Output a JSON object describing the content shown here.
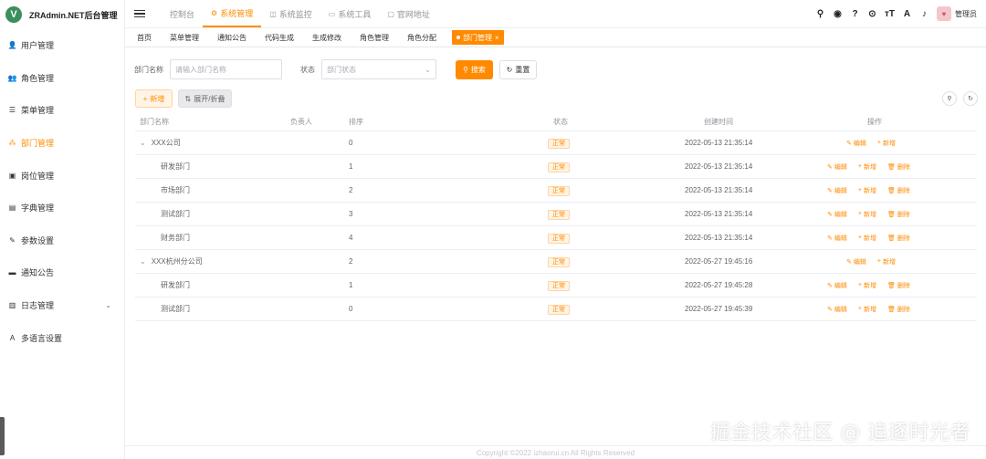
{
  "app": {
    "logo_letter": "V",
    "title": "ZRAdmin.NET后台管理"
  },
  "sidebar": {
    "items": [
      {
        "label": "用户管理",
        "icon": "user-icon",
        "glyph": "👤",
        "active": false
      },
      {
        "label": "角色管理",
        "icon": "role-icon",
        "glyph": "👥",
        "active": false
      },
      {
        "label": "菜单管理",
        "icon": "menu-list-icon",
        "glyph": "☰",
        "active": false
      },
      {
        "label": "部门管理",
        "icon": "tree-icon",
        "glyph": "⁂",
        "active": true
      },
      {
        "label": "岗位管理",
        "icon": "post-icon",
        "glyph": "▣",
        "active": false
      },
      {
        "label": "字典管理",
        "icon": "dict-icon",
        "glyph": "▤",
        "active": false
      },
      {
        "label": "参数设置",
        "icon": "edit-icon",
        "glyph": "✎",
        "active": false
      },
      {
        "label": "通知公告",
        "icon": "message-icon",
        "glyph": "▬",
        "active": false
      },
      {
        "label": "日志管理",
        "icon": "log-icon",
        "glyph": "▥",
        "active": false,
        "expandable": true
      },
      {
        "label": "多语言设置",
        "icon": "language-icon",
        "glyph": "A",
        "active": false
      }
    ]
  },
  "topnav": {
    "items": [
      {
        "label": "控制台",
        "glyph": "",
        "active": false
      },
      {
        "label": "系统管理",
        "glyph": "⚙",
        "active": true
      },
      {
        "label": "系统监控",
        "glyph": "◫",
        "active": false
      },
      {
        "label": "系统工具",
        "glyph": "▭",
        "active": false
      },
      {
        "label": "官网地址",
        "glyph": "▢",
        "active": false
      }
    ]
  },
  "header_right": {
    "icons": [
      {
        "name": "search-icon",
        "glyph": "⚲"
      },
      {
        "name": "github-icon",
        "glyph": "◉"
      },
      {
        "name": "question-icon",
        "glyph": "?"
      },
      {
        "name": "fullscreen-icon",
        "glyph": "⊙"
      },
      {
        "name": "font-size-icon",
        "glyph": "тT"
      },
      {
        "name": "translate-icon",
        "glyph": "A"
      },
      {
        "name": "bell-icon",
        "glyph": "♪"
      }
    ],
    "username": "管理员"
  },
  "tags": {
    "items": [
      "首页",
      "菜单管理",
      "通知公告",
      "代码生成",
      "生成修改",
      "角色管理",
      "角色分配"
    ],
    "active": "部门管理",
    "close": "×"
  },
  "search": {
    "dept_label": "部门名称",
    "dept_placeholder": "请输入部门名称",
    "status_label": "状态",
    "status_placeholder": "部门状态",
    "search_btn": "搜索",
    "reset_btn": "重置"
  },
  "toolbar": {
    "add_btn": "新增",
    "expand_btn": "展开/折叠"
  },
  "table": {
    "headers": {
      "name": "部门名称",
      "leader": "负责人",
      "sort": "排序",
      "status": "状态",
      "created": "创建时间",
      "ops": "操作"
    },
    "ops": {
      "edit": "编辑",
      "add": "新增",
      "delete": "删除"
    },
    "rows": [
      {
        "name": "XXX公司",
        "level": 0,
        "sort": "0",
        "status": "正常",
        "created": "2022-05-13 21:35:14",
        "deletable": false
      },
      {
        "name": "研发部门",
        "level": 1,
        "sort": "1",
        "status": "正常",
        "created": "2022-05-13 21:35:14",
        "deletable": true
      },
      {
        "name": "市场部门",
        "level": 1,
        "sort": "2",
        "status": "正常",
        "created": "2022-05-13 21:35:14",
        "deletable": true
      },
      {
        "name": "测试部门",
        "level": 1,
        "sort": "3",
        "status": "正常",
        "created": "2022-05-13 21:35:14",
        "deletable": true
      },
      {
        "name": "财务部门",
        "level": 1,
        "sort": "4",
        "status": "正常",
        "created": "2022-05-13 21:35:14",
        "deletable": true
      },
      {
        "name": "XXX杭州分公司",
        "level": 0,
        "sort": "2",
        "status": "正常",
        "created": "2022-05-27 19:45:16",
        "deletable": false
      },
      {
        "name": "研发部门",
        "level": 1,
        "sort": "1",
        "status": "正常",
        "created": "2022-05-27 19:45:28",
        "deletable": true
      },
      {
        "name": "测试部门",
        "level": 1,
        "sort": "0",
        "status": "正常",
        "created": "2022-05-27 19:45:39",
        "deletable": true
      }
    ]
  },
  "footer": "Copyright ©2022 izhaorui.cn All Rights Reserved",
  "watermark": "掘金技术社区 @ 追逐时光者",
  "colors": {
    "accent": "#ff8a00"
  }
}
